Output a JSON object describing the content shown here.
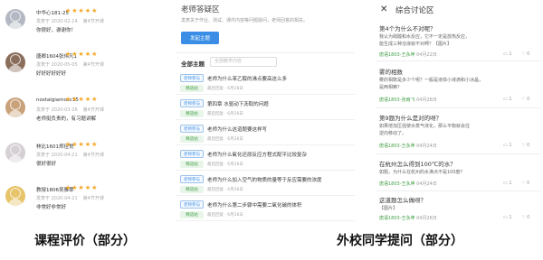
{
  "reviews": [
    {
      "user": "中华心181-25",
      "stars": "★★★★★",
      "date": "发表于 2020-02-14",
      "progress": "第4节开课",
      "text": "你很好，谢谢你！",
      "avatar_color": "#b3b8c2"
    },
    {
      "user": "唐卿1604张伟凡1",
      "stars": "★★★★★",
      "date": "发表于 2020-05-05",
      "progress": "第4节开课",
      "text": "好好好好好好",
      "avatar_color": "#8a6d5a"
    },
    {
      "user": "nostalgiamocc15",
      "stars": "★★★★★",
      "date": "发表于 2020-03-26",
      "progress": "第4节开课",
      "text": "老师挺负责的，有习题讲解",
      "avatar_color": "#c9a27a"
    },
    {
      "user": "林比1601郑佳悦",
      "stars": "★★★★★",
      "date": "发表于 2020-04-21",
      "progress": "第4节开课",
      "text": "很好很好",
      "avatar_color": "#d6d0d4"
    },
    {
      "user": "教授1806吴雅翠",
      "stars": "★★★★★",
      "date": "发表于 2020-04-21",
      "progress": "第4节开课",
      "text": "非常好非常好",
      "avatar_color": "#e7c36a"
    }
  ],
  "qa": {
    "title": "老师答疑区",
    "subtitle": "发表关于作业、测试、课件内容等问题疑问，老师回答的相关。",
    "post_button": "发起主题",
    "filter_label": "全部主题",
    "filter_placeholder": "全部教学内容",
    "threads": [
      {
        "badge": "老师参与",
        "title": "老师为什么苯乙醇的沸点要高这么多",
        "tag": "精选帖",
        "meta": "最后回复 · 6月28日"
      },
      {
        "badge": "老师参与",
        "title": "第四章 水驱动下沥取的问题",
        "tag": "精选帖",
        "meta": "最后回复 · 6月28日"
      },
      {
        "badge": "老师参与",
        "title": "老师为什么这道题要这样写",
        "tag": "精选帖",
        "meta": "最后回复 · 6月28日"
      },
      {
        "badge": "老师参与",
        "title": "老师为什么氧化还原反应方程式配平比较复杂",
        "tag": "精选帖",
        "meta": "最后回复 · 6月28日"
      },
      {
        "badge": "老师参与",
        "title": "老师为什么加入空气的物质的量等于反应需要的浓度",
        "tag": "精选帖",
        "meta": "最后回复 · 6月28日"
      },
      {
        "badge": "老师参与",
        "title": "老师为什么第二步骤中需要二氧化碳的体积",
        "tag": "精选帖",
        "meta": "最后回复 · 6月28日"
      }
    ]
  },
  "discussion": {
    "close_icon": "✕",
    "title": "综合讨论区",
    "cards": [
      {
        "title": "第4个为什么不对呢？",
        "body": [
          "我认为硫酸和水反应，它不一定是放热反应，",
          "能生成三种溶液就不对啊？【图片】"
        ],
        "author": "唐语1803-王永坤",
        "date": "04月22日",
        "replies": "1",
        "likes": "0"
      },
      {
        "title": "雾的相数",
        "body": [
          "雾的相数是多少个呢？一般是液体小液滴和小冰晶，",
          "是两相嘛？"
        ],
        "author": "唐语1803-张雨飞",
        "date": "04月26日",
        "replies": "1",
        "likes": "0"
      },
      {
        "title": "第9题为什么是对的呀？",
        "body": [
          "如果增加压强使水蒸气液化，那么平衡就会往",
          "逆向移动了。"
        ],
        "author": "唐语1803-王永坤",
        "date": "04月24日",
        "replies": "1",
        "likes": "0"
      },
      {
        "title": "在杭州怎么得到100℃的水？",
        "body": [
          "如题，为什么在杭州的水沸点不是100度？"
        ],
        "author": "唐语1803-王永坤",
        "date": "04月24日",
        "replies": "1",
        "likes": "0"
      },
      {
        "title": "这道题怎么做呀？",
        "body": [
          "【图片】"
        ],
        "author": "唐语1803-王永坤",
        "date": "04月26日",
        "replies": "1",
        "likes": "0"
      }
    ]
  },
  "captions": {
    "left": "课程评价（部分）",
    "right": "外校同学提问（部分）"
  }
}
